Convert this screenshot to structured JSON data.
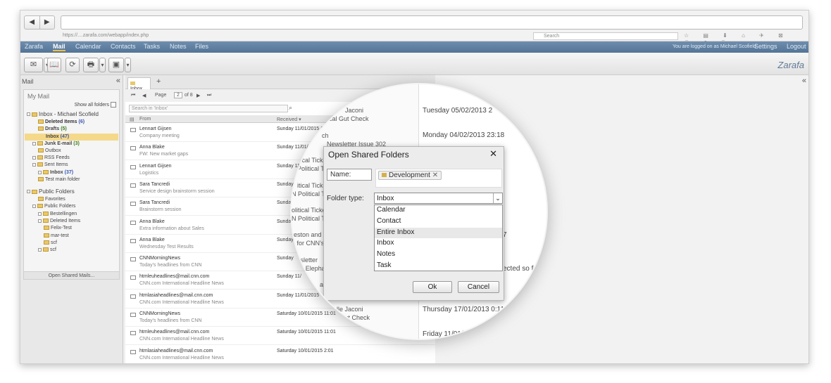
{
  "browser": {
    "url": "https://....zarafa.com/webapp/index.php",
    "search_placeholder": "Search",
    "nav_back": "◀",
    "nav_forward": "▶",
    "icons": "☆ ▤ ⬇ ⌂ ✈ ⊠ ☺ ● ≡"
  },
  "nav": {
    "items": [
      "Zarafa",
      "Mail",
      "Calendar",
      "Contacts",
      "Tasks",
      "Notes",
      "Files"
    ],
    "logged": "You are logged on as Michael Scofield",
    "settings": "Settings",
    "logout": "Logout"
  },
  "toolbar": {
    "logo": "Zarafa",
    "b1": "✉",
    "b2": "📖",
    "b3": "⟳",
    "b4": "🖶",
    "b5": "▣",
    "dd": "▾"
  },
  "left": {
    "title": "Mail",
    "collapse": "«",
    "my_mail": "My Mail",
    "show_all": "Show all folders",
    "open_shared": "Open Shared Mails...",
    "tree": [
      {
        "label": "Inbox - Michael Scofield",
        "cnt": ""
      },
      {
        "label": "Deleted Items",
        "cnt": "(6)"
      },
      {
        "label": "Drafts",
        "cnt": "(5)"
      },
      {
        "label": "Inbox",
        "cnt": "(47)"
      },
      {
        "label": "Junk E-mail",
        "cnt": "(3)"
      },
      {
        "label": "Outbox",
        "cnt": ""
      },
      {
        "label": "RSS Feeds",
        "cnt": ""
      },
      {
        "label": "Sent Items",
        "cnt": ""
      },
      {
        "label": "Inbox",
        "cnt": "(37)"
      },
      {
        "label": "Test main folder",
        "cnt": ""
      },
      {
        "label": "Public Folders",
        "cnt": ""
      },
      {
        "label": "Favorites",
        "cnt": ""
      },
      {
        "label": "Public Folders",
        "cnt": ""
      },
      {
        "label": "Bestellingen",
        "cnt": ""
      },
      {
        "label": "Deleted Items",
        "cnt": ""
      },
      {
        "label": "Felix-Test",
        "cnt": ""
      },
      {
        "label": "mar-test",
        "cnt": ""
      },
      {
        "label": "scf",
        "cnt": ""
      },
      {
        "label": "scf",
        "cnt": ""
      }
    ]
  },
  "center": {
    "tab": "Inbox",
    "tab_add": "+",
    "page_label": "Page",
    "page": "2",
    "page_of": "of 8",
    "search": "Search in 'Inbox'",
    "col_from": "From",
    "col_received": "Received ▾",
    "rows": [
      {
        "from": "Lennart Gijsen",
        "subj": "Company meeting",
        "date": "Sunday 11/01/2015 11:1"
      },
      {
        "from": "Anna Blake",
        "subj": "FW: New market gaps",
        "date": "Sunday 11/01/2015 11:0"
      },
      {
        "from": "Lennart Gijsen",
        "subj": "Logistics",
        "date": "Sunday 11/01/2015 11:0"
      },
      {
        "from": "Sara Tancredi",
        "subj": "Service design brainstorm session",
        "date": "Sunday 11/01/2015 11:0"
      },
      {
        "from": "Sara Tancredi",
        "subj": "Brainstorm session",
        "date": "Sunday 11/01"
      },
      {
        "from": "Anna Blake",
        "subj": "Extra information about Sales",
        "date": "Sunday"
      },
      {
        "from": "Anna Blake",
        "subj": "Wednesday Test Results",
        "date": "Sunday"
      },
      {
        "from": "CNNMorningNews",
        "subj": "Today's headlines from CNN",
        "date": "Sunday"
      },
      {
        "from": "htmleuheadlines@mail.cnn.com",
        "subj": "CNN.com International Headline News",
        "date": "Sunday 11/"
      },
      {
        "from": "htmlasiaheadlines@mail.cnn.com",
        "subj": "CNN.com International Headline News",
        "date": "Sunday 11/01/2015"
      },
      {
        "from": "CNNMorningNews",
        "subj": "Today's headlines from CNN",
        "date": "Saturday 10/01/2015 11:01"
      },
      {
        "from": "htmleuheadlines@mail.cnn.com",
        "subj": "CNN.com International Headline News",
        "date": "Saturday 10/01/2015 11:01"
      },
      {
        "from": "htmlasiaheadlines@mail.cnn.com",
        "subj": "CNN.com International Headline News",
        "date": "Saturday 10/01/2015 2:01"
      }
    ]
  },
  "mag": {
    "left": [
      "Jaconi",
      "ical Gut Check",
      "ch",
      "Newsletter Issue 302",
      "itical Ticker",
      "Political Ti",
      "itical Ticker",
      "N Political Ti",
      "olitical Ticker",
      "N Political Ti",
      "reston and M",
      "e for CNN's F",
      "wsletter",
      "n's Elephant",
      "and M",
      "Michelle Jaconi",
      "itical Gut Check",
      "Jaconi"
    ],
    "right": [
      "Tuesday 05/02/2013 2",
      "Monday 04/02/2013 23:18",
      "7",
      "ected so fa",
      "Thursday 17/01/2013 0:11",
      "Friday 11/01/2013 2"
    ]
  },
  "dialog": {
    "title": "Open Shared Folders",
    "close": "✕",
    "name_label": "Name:",
    "chip": "Development",
    "chip_x": "✕",
    "folder_type_label": "Folder type:",
    "selected": "Inbox",
    "arrow": "⌄",
    "options": [
      "Calendar",
      "Contact",
      "Entire Inbox",
      "Inbox",
      "Notes",
      "Task"
    ],
    "ok": "Ok",
    "cancel": "Cancel"
  }
}
